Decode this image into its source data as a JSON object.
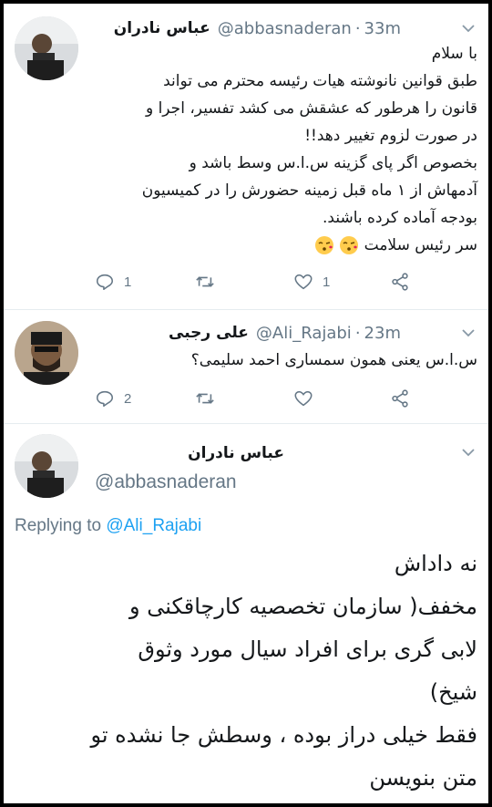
{
  "tweets": [
    {
      "name": "عباس نادران",
      "handle": "@abbasnaderan",
      "separator": "·",
      "time": "33m",
      "lines": [
        "با سلام",
        "طبق قوانین نانوشته هیات رئیسه محترم می تواند",
        "قانون را هرطور که عشقش می کشد تفسیر، اجرا و",
        "در صورت لزوم تغییر دهد!!",
        "بخصوص اگر پای گزینه س.ا.س وسط باشد و",
        "آدمهاش از ۱ ماه قبل زمینه حضورش را در کمیسیون",
        "بودجه آماده کرده باشند.",
        "سر رئیس سلامت"
      ],
      "emoji": [
        "kissing-face-emoji",
        "kissing-face-emoji"
      ],
      "reply_count": "1",
      "retweet_count": "",
      "like_count": "1"
    },
    {
      "name": "علی رجبی",
      "handle": "@Ali_Rajabi",
      "separator": "·",
      "time": "23m",
      "lines": [
        "س.ا.س یعنی همون سمساری احمد سلیمی؟"
      ],
      "reply_count": "2",
      "retweet_count": "",
      "like_count": ""
    }
  ],
  "main_tweet": {
    "name": "عباس نادران",
    "handle": "@abbasnaderan",
    "replying_prefix": "Replying to ",
    "replying_to": "@Ali_Rajabi",
    "lines": [
      "نه داداش",
      "مخفف( سازمان تخصصیه کارچاقکنی و",
      "لابی گری برای افراد  سیال مورد وثوق",
      "شیخ)",
      "فقط خیلی دراز بوده ، وسطش جا نشده تو",
      "متن بنویسن"
    ]
  },
  "colors": {
    "text": "#14171a",
    "secondary": "#657786",
    "link": "#1da1f2",
    "divider": "#e6ecf0"
  }
}
